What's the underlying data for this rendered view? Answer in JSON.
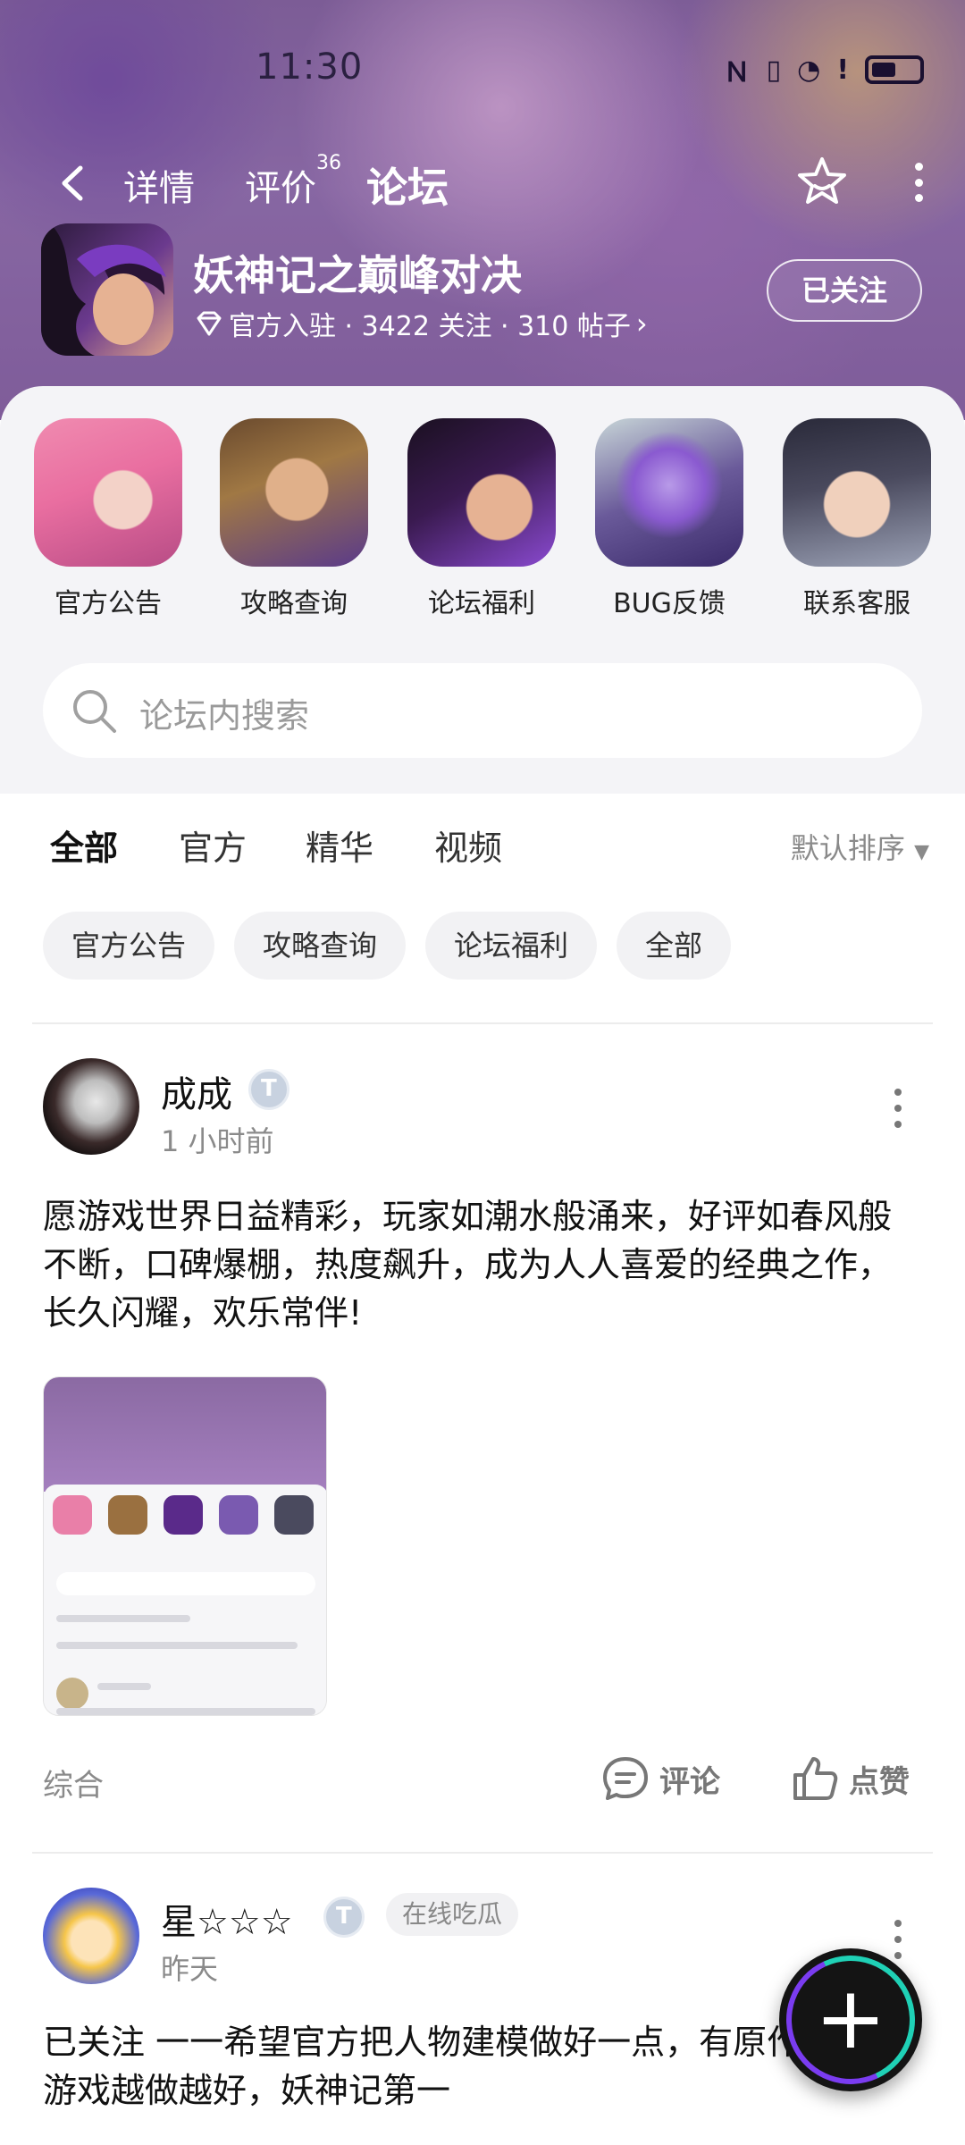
{
  "status_bar": {
    "time": "11:30"
  },
  "nav": {
    "tabs": [
      {
        "label": "详情"
      },
      {
        "label": "评价",
        "badge": "36"
      },
      {
        "label": "论坛"
      }
    ],
    "active_tab": "论坛"
  },
  "game": {
    "title": "妖神记之巅峰对决",
    "meta": "官方入驻 · 3422 关注 · 310 帖子",
    "follow_label": "已关注"
  },
  "shortcuts": [
    {
      "label": "官方公告"
    },
    {
      "label": "攻略查询"
    },
    {
      "label": "论坛福利"
    },
    {
      "label": "BUG反馈"
    },
    {
      "label": "联系客服"
    }
  ],
  "search": {
    "placeholder": "论坛内搜索"
  },
  "filter_tabs": [
    {
      "label": "全部"
    },
    {
      "label": "官方"
    },
    {
      "label": "精华"
    },
    {
      "label": "视频"
    }
  ],
  "sort_label": "默认排序",
  "chips": [
    {
      "label": "官方公告"
    },
    {
      "label": "攻略查询"
    },
    {
      "label": "论坛福利"
    },
    {
      "label": "全部"
    }
  ],
  "posts": [
    {
      "user": "成成",
      "time": "1 小时前",
      "body": "愿游戏世界日益精彩，玩家如潮水般涌来，好评如春风般不断，口碑爆棚，热度飙升，成为人人喜爱的经典之作，长久闪耀，欢乐常伴!",
      "tag": "综合",
      "comment_label": "评论",
      "like_label": "点赞"
    },
    {
      "user": "星☆☆☆",
      "time": "昨天",
      "badge_text": "在线吃瓜",
      "body": "已关注 一一希望官方把人物建模做好一点，有原作味道！ 游戏越做越好，妖神记第一"
    }
  ],
  "colors": {
    "accent": "#1fd1b6",
    "hero_bg": "#9a78b4",
    "panel_bg": "#f4f4f7"
  }
}
